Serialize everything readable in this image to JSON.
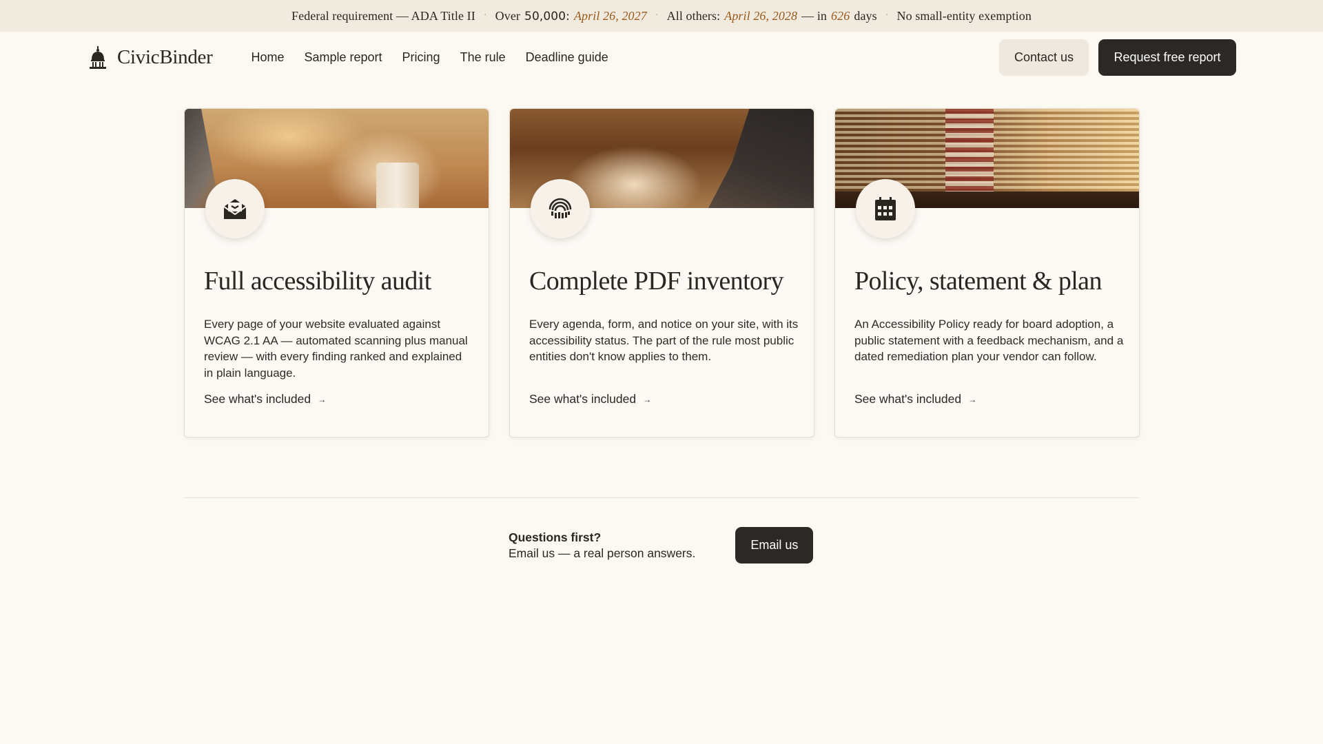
{
  "topbar": {
    "seg1": "Federal requirement — ADA Title II",
    "seg2_prefix": "Over",
    "seg2_number": "50,000:",
    "seg2_date": "April 26, 2027",
    "seg3_prefix": "All others:",
    "seg3_date": "April 26, 2028",
    "seg3_mid": "— in",
    "seg3_days": "626",
    "seg3_suffix": "days",
    "seg4": "No small-entity exemption",
    "highlight_color": "#9a5a1a"
  },
  "nav": {
    "logo_text": "CivicBinder",
    "logo_icon": "capitol-dome-icon",
    "menu": [
      "Home",
      "Sample report",
      "Pricing",
      "The rule",
      "Deadline guide"
    ],
    "contact_label": "Contact us",
    "request_label": "Request free report"
  },
  "cards": [
    {
      "icon": "envelope-open-icon",
      "title": "Full accessibility audit",
      "body": "Every page of your website evaluated against WCAG 2.1 AA — automated scanning plus manual review — with every finding ranked and explained in plain language.",
      "link": "See what's included"
    },
    {
      "icon": "fingerprint-icon",
      "title": "Complete PDF inventory",
      "body": "Every agenda, form, and notice on your site, with its accessibility status. The part of the rule most public entities don't know applies to them.",
      "link": "See what's included"
    },
    {
      "icon": "calendar-icon",
      "title": "Policy, statement & plan",
      "body": "An Accessibility Policy ready for board adoption, a public statement with a feedback mechanism, and a dated remediation plan your vendor can follow.",
      "link": "See what's included"
    }
  ],
  "cta": {
    "question": "Questions first?",
    "subtext": "Email us — a real person answers.",
    "button": "Email us"
  },
  "colors": {
    "background": "#fcf8f2",
    "topbar": "#f1eadf",
    "dark_button": "#2b2825",
    "light_button": "#efe8de"
  }
}
